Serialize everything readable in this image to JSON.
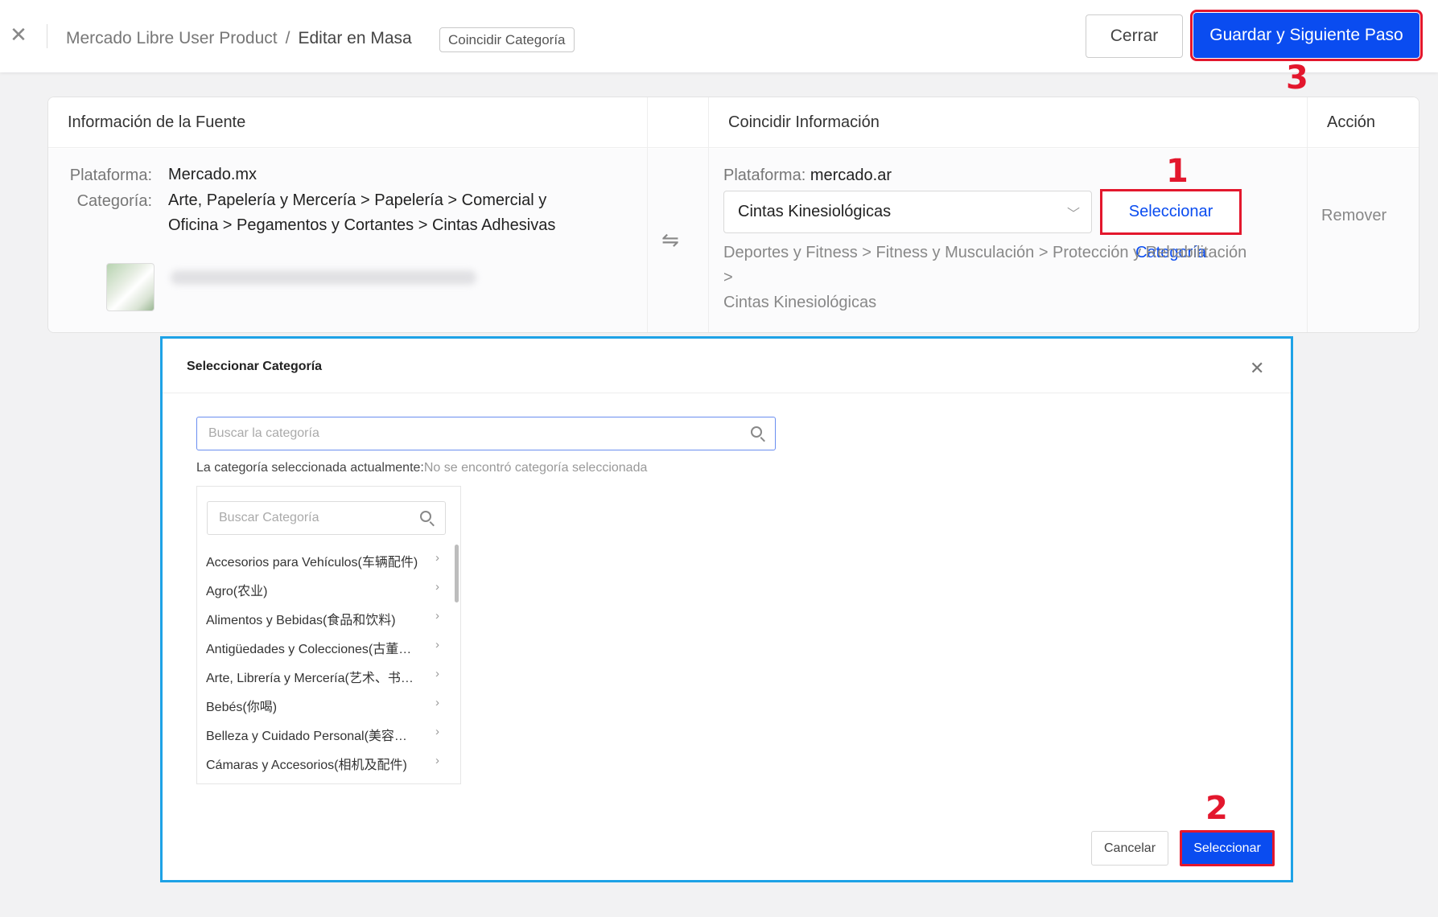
{
  "header": {
    "breadcrumb": [
      "Mercado Libre User Product",
      "Editar en Masa"
    ],
    "breadcrumb_sep": "/",
    "tag": "Coincidir Categoría",
    "close_label": "Cerrar",
    "save_label": "Guardar y Siguiente Paso"
  },
  "annotations": {
    "step1": "1",
    "step2": "2",
    "step3": "3"
  },
  "table": {
    "headers": {
      "source": "Información de la Fuente",
      "match": "Coincidir Información",
      "action": "Acción"
    },
    "row": {
      "source": {
        "platform_label": "Plataforma:",
        "platform": "Mercado.mx",
        "category_label": "Categoría:",
        "category_line1": "Arte, Papelería y Mercería > Papelería > Comercial y",
        "category_line2": "Oficina > Pegamentos y Cortantes > Cintas Adhesivas"
      },
      "match": {
        "platform_label": "Plataforma:",
        "platform": "mercado.ar",
        "selected_category": "Cintas Kinesiológicas",
        "select_button": "Seleccionar Categoría",
        "path_line1": "Deportes y Fitness > Fitness y Musculación > Protección y Rehabilitación >",
        "path_line2": "Cintas Kinesiológicas"
      },
      "action": "Remover"
    }
  },
  "modal": {
    "title": "Seleccionar Categoría",
    "search_placeholder": "Buscar la categoría",
    "current_label": "La categoría seleccionada actualmente:",
    "current_value": "No se encontró categoría seleccionada",
    "tree_search_placeholder": "Buscar Categoría",
    "categories": [
      "Accesorios para Vehículos(车辆配件)",
      "Agro(农业)",
      "Alimentos y Bebidas(食品和饮料)",
      "Antigüedades y Colecciones(古董…",
      "Arte, Librería y Mercería(艺术、书…",
      "Bebés(你喝)",
      "Belleza y Cuidado Personal(美容…",
      "Cámaras y Accesorios(相机及配件)"
    ],
    "cancel_label": "Cancelar",
    "select_label": "Seleccionar"
  },
  "colors": {
    "primary": "#0a4cf0",
    "annotation": "#e3172d",
    "modal_border": "#1ea2e6"
  }
}
